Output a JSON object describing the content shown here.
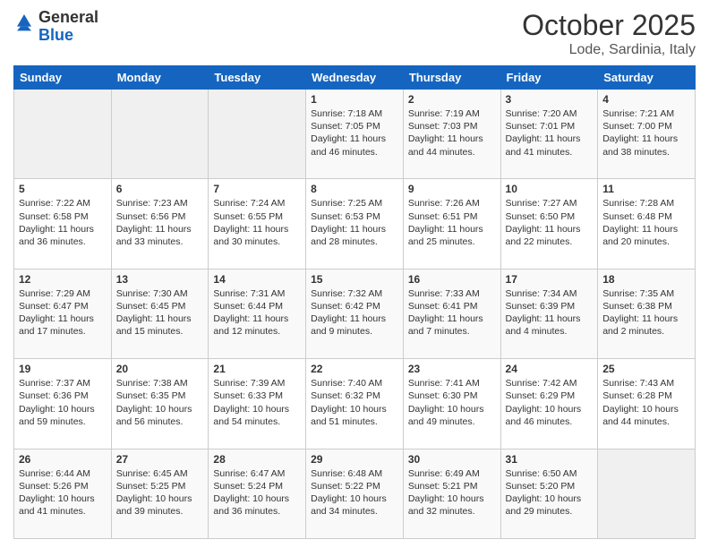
{
  "header": {
    "logo_general": "General",
    "logo_blue": "Blue",
    "month_title": "October 2025",
    "location": "Lode, Sardinia, Italy"
  },
  "weekdays": [
    "Sunday",
    "Monday",
    "Tuesday",
    "Wednesday",
    "Thursday",
    "Friday",
    "Saturday"
  ],
  "weeks": [
    [
      {
        "day": "",
        "info": ""
      },
      {
        "day": "",
        "info": ""
      },
      {
        "day": "",
        "info": ""
      },
      {
        "day": "1",
        "info": "Sunrise: 7:18 AM\nSunset: 7:05 PM\nDaylight: 11 hours and 46 minutes."
      },
      {
        "day": "2",
        "info": "Sunrise: 7:19 AM\nSunset: 7:03 PM\nDaylight: 11 hours and 44 minutes."
      },
      {
        "day": "3",
        "info": "Sunrise: 7:20 AM\nSunset: 7:01 PM\nDaylight: 11 hours and 41 minutes."
      },
      {
        "day": "4",
        "info": "Sunrise: 7:21 AM\nSunset: 7:00 PM\nDaylight: 11 hours and 38 minutes."
      }
    ],
    [
      {
        "day": "5",
        "info": "Sunrise: 7:22 AM\nSunset: 6:58 PM\nDaylight: 11 hours and 36 minutes."
      },
      {
        "day": "6",
        "info": "Sunrise: 7:23 AM\nSunset: 6:56 PM\nDaylight: 11 hours and 33 minutes."
      },
      {
        "day": "7",
        "info": "Sunrise: 7:24 AM\nSunset: 6:55 PM\nDaylight: 11 hours and 30 minutes."
      },
      {
        "day": "8",
        "info": "Sunrise: 7:25 AM\nSunset: 6:53 PM\nDaylight: 11 hours and 28 minutes."
      },
      {
        "day": "9",
        "info": "Sunrise: 7:26 AM\nSunset: 6:51 PM\nDaylight: 11 hours and 25 minutes."
      },
      {
        "day": "10",
        "info": "Sunrise: 7:27 AM\nSunset: 6:50 PM\nDaylight: 11 hours and 22 minutes."
      },
      {
        "day": "11",
        "info": "Sunrise: 7:28 AM\nSunset: 6:48 PM\nDaylight: 11 hours and 20 minutes."
      }
    ],
    [
      {
        "day": "12",
        "info": "Sunrise: 7:29 AM\nSunset: 6:47 PM\nDaylight: 11 hours and 17 minutes."
      },
      {
        "day": "13",
        "info": "Sunrise: 7:30 AM\nSunset: 6:45 PM\nDaylight: 11 hours and 15 minutes."
      },
      {
        "day": "14",
        "info": "Sunrise: 7:31 AM\nSunset: 6:44 PM\nDaylight: 11 hours and 12 minutes."
      },
      {
        "day": "15",
        "info": "Sunrise: 7:32 AM\nSunset: 6:42 PM\nDaylight: 11 hours and 9 minutes."
      },
      {
        "day": "16",
        "info": "Sunrise: 7:33 AM\nSunset: 6:41 PM\nDaylight: 11 hours and 7 minutes."
      },
      {
        "day": "17",
        "info": "Sunrise: 7:34 AM\nSunset: 6:39 PM\nDaylight: 11 hours and 4 minutes."
      },
      {
        "day": "18",
        "info": "Sunrise: 7:35 AM\nSunset: 6:38 PM\nDaylight: 11 hours and 2 minutes."
      }
    ],
    [
      {
        "day": "19",
        "info": "Sunrise: 7:37 AM\nSunset: 6:36 PM\nDaylight: 10 hours and 59 minutes."
      },
      {
        "day": "20",
        "info": "Sunrise: 7:38 AM\nSunset: 6:35 PM\nDaylight: 10 hours and 56 minutes."
      },
      {
        "day": "21",
        "info": "Sunrise: 7:39 AM\nSunset: 6:33 PM\nDaylight: 10 hours and 54 minutes."
      },
      {
        "day": "22",
        "info": "Sunrise: 7:40 AM\nSunset: 6:32 PM\nDaylight: 10 hours and 51 minutes."
      },
      {
        "day": "23",
        "info": "Sunrise: 7:41 AM\nSunset: 6:30 PM\nDaylight: 10 hours and 49 minutes."
      },
      {
        "day": "24",
        "info": "Sunrise: 7:42 AM\nSunset: 6:29 PM\nDaylight: 10 hours and 46 minutes."
      },
      {
        "day": "25",
        "info": "Sunrise: 7:43 AM\nSunset: 6:28 PM\nDaylight: 10 hours and 44 minutes."
      }
    ],
    [
      {
        "day": "26",
        "info": "Sunrise: 6:44 AM\nSunset: 5:26 PM\nDaylight: 10 hours and 41 minutes."
      },
      {
        "day": "27",
        "info": "Sunrise: 6:45 AM\nSunset: 5:25 PM\nDaylight: 10 hours and 39 minutes."
      },
      {
        "day": "28",
        "info": "Sunrise: 6:47 AM\nSunset: 5:24 PM\nDaylight: 10 hours and 36 minutes."
      },
      {
        "day": "29",
        "info": "Sunrise: 6:48 AM\nSunset: 5:22 PM\nDaylight: 10 hours and 34 minutes."
      },
      {
        "day": "30",
        "info": "Sunrise: 6:49 AM\nSunset: 5:21 PM\nDaylight: 10 hours and 32 minutes."
      },
      {
        "day": "31",
        "info": "Sunrise: 6:50 AM\nSunset: 5:20 PM\nDaylight: 10 hours and 29 minutes."
      },
      {
        "day": "",
        "info": ""
      }
    ]
  ]
}
